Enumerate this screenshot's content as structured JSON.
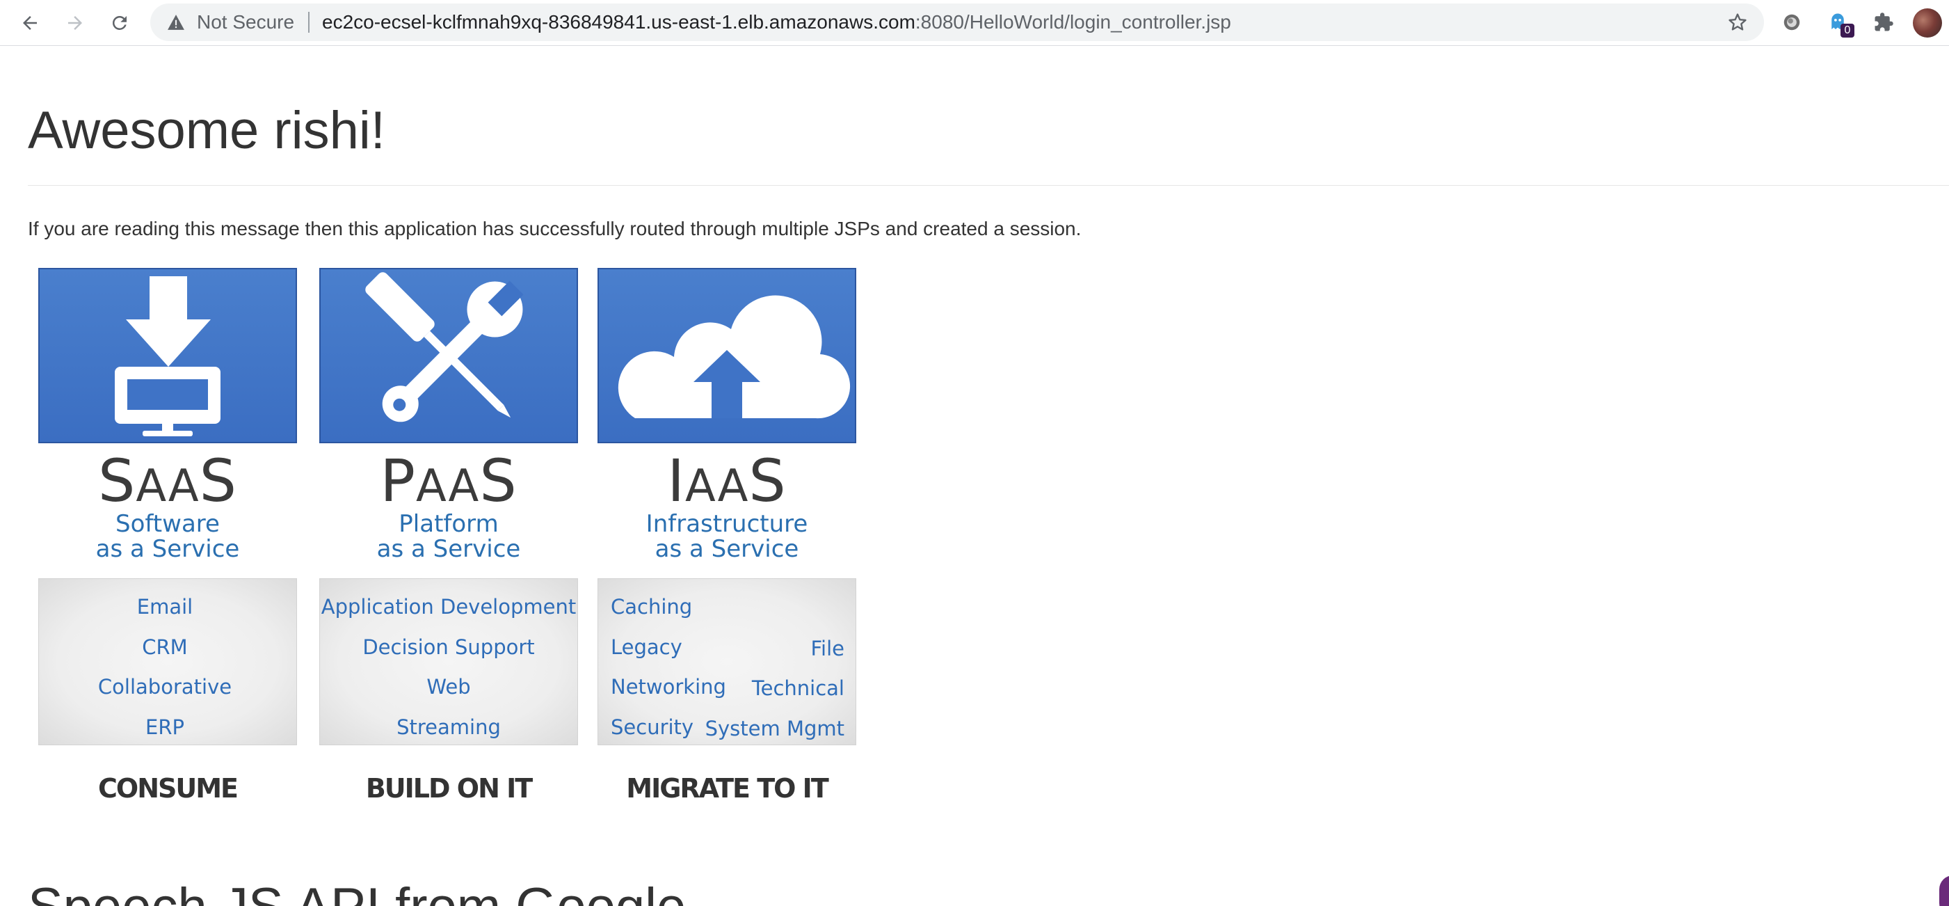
{
  "browser": {
    "security_label": "Not Secure",
    "url_host": "ec2co-ecsel-kclfmnah9xq-836849841.us-east-1.elb.amazonaws.com",
    "url_rest": ":8080/HelloWorld/login_controller.jsp",
    "extension_badge": "0"
  },
  "page": {
    "title": "Awesome rishi!",
    "intro": "If you are reading this message then this application has successfully routed through multiple JSPs and created a session.",
    "next_heading": "Speech JS API from Google"
  },
  "services": [
    {
      "acronym_first": "S",
      "acronym_small": "AA",
      "acronym_last": "S",
      "subtitle_1": "Software",
      "subtitle_2": "as a Service",
      "items": [
        "Email",
        "CRM",
        "Collaborative",
        "ERP"
      ],
      "caption": "CONSUME"
    },
    {
      "acronym_first": "P",
      "acronym_small": "AA",
      "acronym_last": "S",
      "subtitle_1": "Platform",
      "subtitle_2": "as a Service",
      "items": [
        "Application Development",
        "Decision Support",
        "Web",
        "Streaming"
      ],
      "caption": "BUILD ON IT"
    },
    {
      "acronym_first": "I",
      "acronym_small": "AA",
      "acronym_last": "S",
      "subtitle_1": "Infrastructure",
      "subtitle_2": "as a Service",
      "items": [
        "Caching",
        "File",
        "Legacy",
        "Networking",
        "Technical",
        "Security",
        "System Mgmt"
      ],
      "caption": "MIGRATE TO IT"
    }
  ]
}
